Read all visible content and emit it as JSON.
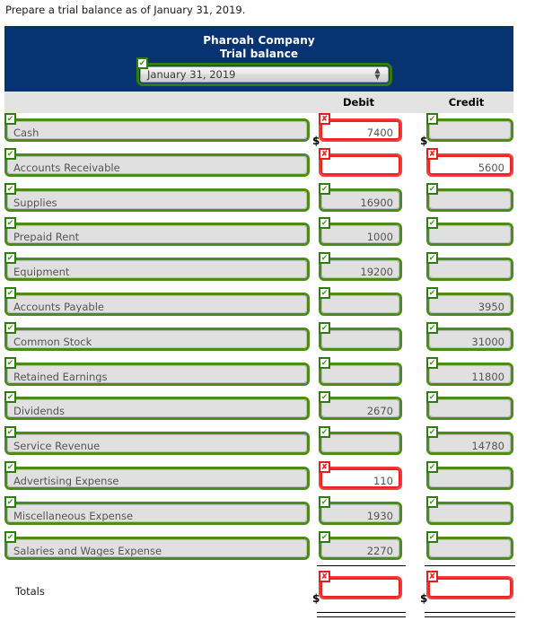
{
  "instruction": "Prepare a trial balance as of January 31, 2019.",
  "header": {
    "company": "Pharoah Company",
    "subtitle": "Trial balance",
    "period_value": "January 31, 2019",
    "period_status": "ok",
    "navy": "#073372"
  },
  "columns": {
    "account": "",
    "debit": "Debit",
    "credit": "Credit"
  },
  "symbols": {
    "dollar": "$",
    "check": "✔",
    "cross": "✘",
    "arrow_up": "▲",
    "arrow_down": "▼"
  },
  "rows": [
    {
      "account": "Cash",
      "account_status": "ok",
      "debit": "7400",
      "debit_status": "bad",
      "credit": "",
      "credit_status": "ok",
      "show_dollar": true
    },
    {
      "account": "Accounts Receivable",
      "account_status": "ok",
      "debit": "",
      "debit_status": "bad",
      "credit": "5600",
      "credit_status": "bad",
      "show_dollar": false
    },
    {
      "account": "Supplies",
      "account_status": "ok",
      "debit": "16900",
      "debit_status": "ok",
      "credit": "",
      "credit_status": "ok",
      "show_dollar": false
    },
    {
      "account": "Prepaid Rent",
      "account_status": "ok",
      "debit": "1000",
      "debit_status": "ok",
      "credit": "",
      "credit_status": "ok",
      "show_dollar": false
    },
    {
      "account": "Equipment",
      "account_status": "ok",
      "debit": "19200",
      "debit_status": "ok",
      "credit": "",
      "credit_status": "ok",
      "show_dollar": false
    },
    {
      "account": "Accounts Payable",
      "account_status": "ok",
      "debit": "",
      "debit_status": "ok",
      "credit": "3950",
      "credit_status": "ok",
      "show_dollar": false
    },
    {
      "account": "Common Stock",
      "account_status": "ok",
      "debit": "",
      "debit_status": "ok",
      "credit": "31000",
      "credit_status": "ok",
      "show_dollar": false
    },
    {
      "account": "Retained Earnings",
      "account_status": "ok",
      "debit": "",
      "debit_status": "ok",
      "credit": "11800",
      "credit_status": "ok",
      "show_dollar": false
    },
    {
      "account": "Dividends",
      "account_status": "ok",
      "debit": "2670",
      "debit_status": "ok",
      "credit": "",
      "credit_status": "ok",
      "show_dollar": false
    },
    {
      "account": "Service Revenue",
      "account_status": "ok",
      "debit": "",
      "debit_status": "ok",
      "credit": "14780",
      "credit_status": "ok",
      "show_dollar": false
    },
    {
      "account": "Advertising Expense",
      "account_status": "ok",
      "debit": "110",
      "debit_status": "bad",
      "credit": "",
      "credit_status": "ok",
      "show_dollar": false
    },
    {
      "account": "Miscellaneous Expense",
      "account_status": "ok",
      "debit": "1930",
      "debit_status": "ok",
      "credit": "",
      "credit_status": "ok",
      "show_dollar": false
    },
    {
      "account": "Salaries and Wages Expense",
      "account_status": "ok",
      "debit": "2270",
      "debit_status": "ok",
      "credit": "",
      "credit_status": "ok",
      "show_dollar": false
    }
  ],
  "totals": {
    "label": "Totals",
    "debit": "",
    "debit_status": "bad",
    "credit": "",
    "credit_status": "bad",
    "show_dollar": true
  }
}
